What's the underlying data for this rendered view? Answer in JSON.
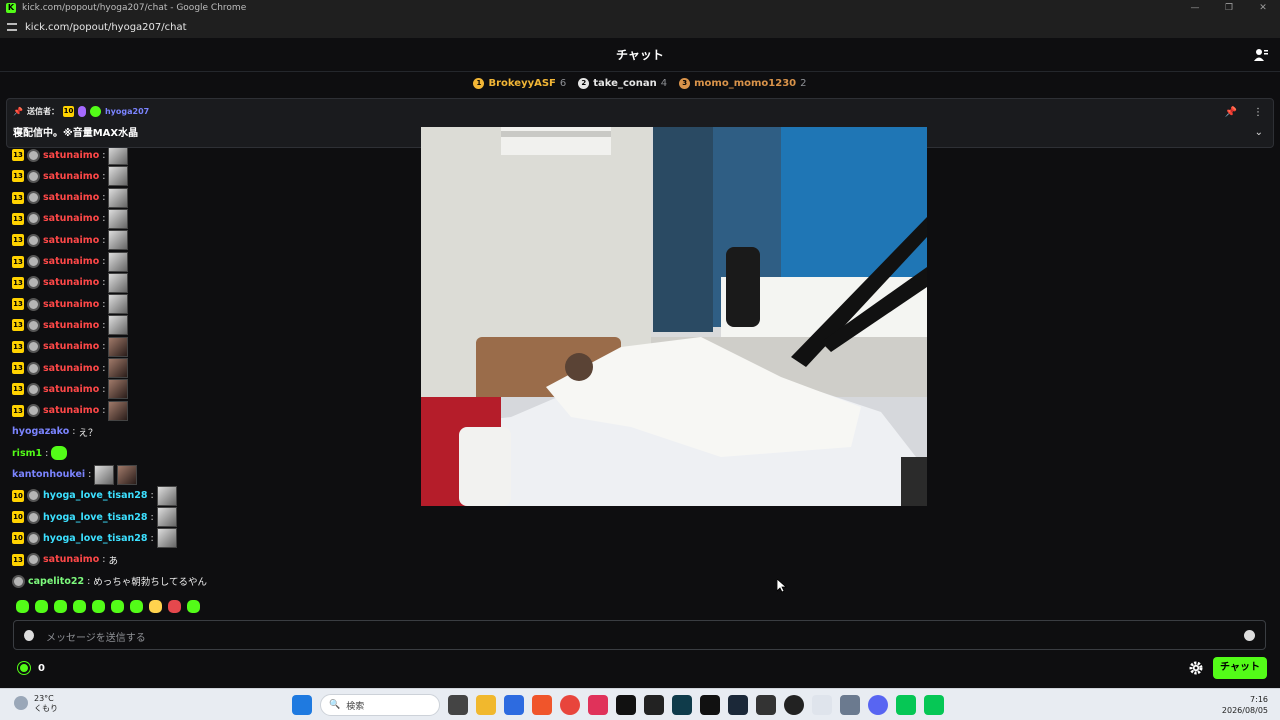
{
  "window": {
    "title": "kick.com/popout/hyoga207/chat - Google Chrome",
    "url": "kick.com/popout/hyoga207/chat",
    "favicon": "K"
  },
  "header": {
    "title": "チャット"
  },
  "leaderboard": [
    {
      "rank": "1",
      "name": "BrokeyyASF",
      "count": "6",
      "color": "#f2b636"
    },
    {
      "rank": "2",
      "name": "take_conan",
      "count": "4",
      "color": "#e6e6e6"
    },
    {
      "rank": "3",
      "name": "momo_momo1230",
      "count": "2",
      "color": "#d9934a"
    }
  ],
  "pinned": {
    "label": "送信者：",
    "sub_badge": "10",
    "user": "hyoga207",
    "message": "寝配信中。※音量MAX水晶"
  },
  "messages": [
    {
      "badge": "13",
      "user": "satunaimo",
      "color": "#ff4848",
      "text": ""
    },
    {
      "badge": "13",
      "user": "satunaimo",
      "color": "#ff4848",
      "text": ""
    },
    {
      "badge": "13",
      "user": "satunaimo",
      "color": "#ff4848",
      "text": ""
    },
    {
      "badge": "13",
      "user": "satunaimo",
      "color": "#ff4848",
      "text": ""
    },
    {
      "badge": "13",
      "user": "satunaimo",
      "color": "#ff4848",
      "text": ""
    },
    {
      "badge": "13",
      "user": "satunaimo",
      "color": "#ff4848",
      "text": ""
    },
    {
      "badge": "13",
      "user": "satunaimo",
      "color": "#ff4848",
      "text": ""
    },
    {
      "badge": "13",
      "user": "satunaimo",
      "color": "#ff4848",
      "text": ""
    },
    {
      "badge": "13",
      "user": "satunaimo",
      "color": "#ff4848",
      "text": ""
    },
    {
      "badge": "13",
      "user": "satunaimo",
      "color": "#ff4848",
      "text": ""
    },
    {
      "badge": "13",
      "user": "satunaimo",
      "color": "#ff4848",
      "text": ""
    },
    {
      "badge": "13",
      "user": "satunaimo",
      "color": "#ff4848",
      "text": ""
    },
    {
      "badge": "13",
      "user": "satunaimo",
      "color": "#ff4848",
      "text": ""
    },
    {
      "badge": "",
      "user": "hyogazako",
      "color": "#7b84ff",
      "text": "え？"
    },
    {
      "badge": "",
      "user": "rism1",
      "color": "#53fc18",
      "text": ""
    },
    {
      "badge": "",
      "user": "kantonhoukei",
      "color": "#7b84ff",
      "text": ""
    },
    {
      "badge": "10",
      "user": "hyoga_love_tisan28",
      "color": "#3ce0ff",
      "text": ""
    },
    {
      "badge": "10",
      "user": "hyoga_love_tisan28",
      "color": "#3ce0ff",
      "text": ""
    },
    {
      "badge": "10",
      "user": "hyoga_love_tisan28",
      "color": "#3ce0ff",
      "text": ""
    },
    {
      "badge": "13",
      "user": "satunaimo",
      "color": "#ff4848",
      "text": "あ"
    },
    {
      "badge": "",
      "user": "capelito22",
      "color": "#7dfa7d",
      "text": "めっちゃ朝勃ちしてるやん"
    }
  ],
  "input": {
    "placeholder": "メッセージを送信する"
  },
  "footer": {
    "points": "0",
    "chat_button": "チャット"
  },
  "taskbar": {
    "weather_temp": "23°C",
    "weather_desc": "くもり",
    "weather_alert": "1",
    "search": "検索",
    "time": "7:16",
    "date": "2026/08/05"
  }
}
